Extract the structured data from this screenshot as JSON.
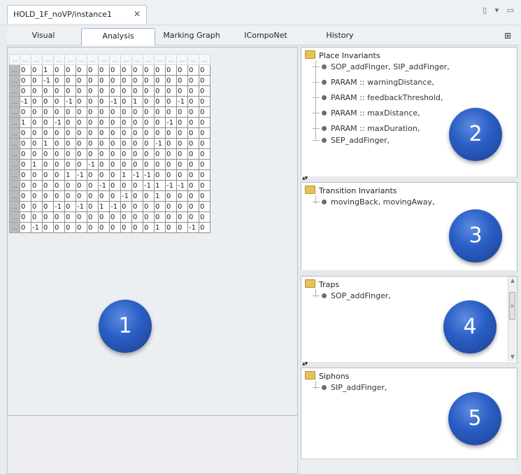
{
  "editor_tab": {
    "title": "HOLD_1F_noVP/instance1",
    "close": "✕"
  },
  "window_controls": {
    "label": "▯ ▾ ▭"
  },
  "view_tabs": [
    {
      "label": "Visual",
      "selected": false
    },
    {
      "label": "Analysis",
      "selected": true
    },
    {
      "label": "Marking Graph",
      "selected": false
    },
    {
      "label": "ICompoNet",
      "selected": false
    },
    {
      "label": "History",
      "selected": false
    }
  ],
  "grid_icon": "⊞",
  "matrix": {
    "header_cell": "...",
    "row_header": "...",
    "rows": [
      [
        0,
        0,
        1,
        0,
        0,
        0,
        0,
        0,
        0,
        0,
        0,
        0,
        0,
        0,
        0,
        0,
        0
      ],
      [
        0,
        0,
        -1,
        0,
        0,
        0,
        0,
        0,
        0,
        0,
        0,
        0,
        0,
        0,
        0,
        0,
        0
      ],
      [
        0,
        0,
        0,
        0,
        0,
        0,
        0,
        0,
        0,
        0,
        0,
        0,
        0,
        0,
        0,
        0,
        0
      ],
      [
        -1,
        0,
        0,
        0,
        -1,
        0,
        0,
        0,
        -1,
        0,
        1,
        0,
        0,
        0,
        -1,
        0,
        0
      ],
      [
        0,
        0,
        0,
        0,
        0,
        0,
        0,
        0,
        0,
        0,
        0,
        0,
        0,
        0,
        0,
        0,
        0
      ],
      [
        1,
        0,
        0,
        -1,
        0,
        0,
        0,
        0,
        0,
        0,
        0,
        0,
        0,
        -1,
        0,
        0,
        0
      ],
      [
        0,
        0,
        0,
        0,
        0,
        0,
        0,
        0,
        0,
        0,
        0,
        0,
        0,
        0,
        0,
        0,
        0
      ],
      [
        0,
        0,
        1,
        0,
        0,
        0,
        0,
        0,
        0,
        0,
        0,
        0,
        -1,
        0,
        0,
        0,
        0
      ],
      [
        0,
        0,
        0,
        0,
        0,
        0,
        0,
        0,
        0,
        0,
        0,
        0,
        0,
        0,
        0,
        0,
        0
      ],
      [
        0,
        1,
        0,
        0,
        0,
        0,
        -1,
        0,
        0,
        0,
        0,
        0,
        0,
        0,
        0,
        0,
        0
      ],
      [
        0,
        0,
        0,
        0,
        1,
        -1,
        0,
        0,
        0,
        1,
        -1,
        -1,
        0,
        0,
        0,
        0,
        0
      ],
      [
        0,
        0,
        0,
        0,
        0,
        0,
        0,
        -1,
        0,
        0,
        0,
        -1,
        1,
        -1,
        -1,
        0,
        0
      ],
      [
        0,
        0,
        0,
        0,
        0,
        0,
        0,
        0,
        0,
        -1,
        0,
        0,
        1,
        0,
        0,
        0,
        0
      ],
      [
        0,
        0,
        0,
        -1,
        0,
        -1,
        0,
        1,
        -1,
        0,
        0,
        0,
        0,
        0,
        0,
        0,
        0
      ],
      [
        0,
        0,
        0,
        0,
        0,
        0,
        0,
        0,
        0,
        0,
        0,
        0,
        0,
        0,
        0,
        0,
        0
      ],
      [
        0,
        -1,
        0,
        0,
        0,
        0,
        0,
        0,
        0,
        0,
        0,
        0,
        1,
        0,
        0,
        -1,
        0
      ]
    ]
  },
  "panels": {
    "place_invariants": {
      "title": "Place Invariants",
      "items": [
        "SOP_addFinger, SIP_addFinger,",
        "PARAM :: warningDistance,",
        "PARAM :: feedbackThreshold,",
        "PARAM :: maxDistance,",
        "PARAM :: maxDuration,",
        "SEP_addFinger,"
      ]
    },
    "transition_invariants": {
      "title": "Transition Invariants",
      "items": [
        "movingBack, movingAway,"
      ]
    },
    "traps": {
      "title": "Traps",
      "items": [
        "SOP_addFinger,"
      ]
    },
    "siphons": {
      "title": "Siphons",
      "items": [
        "SIP_addFinger,"
      ]
    }
  },
  "callouts": [
    "1",
    "2",
    "3",
    "4",
    "5"
  ],
  "colors": {
    "callout_blue": "#2a5fc6",
    "folder": "#e6c25a",
    "row_header": "#b9bcbf"
  }
}
